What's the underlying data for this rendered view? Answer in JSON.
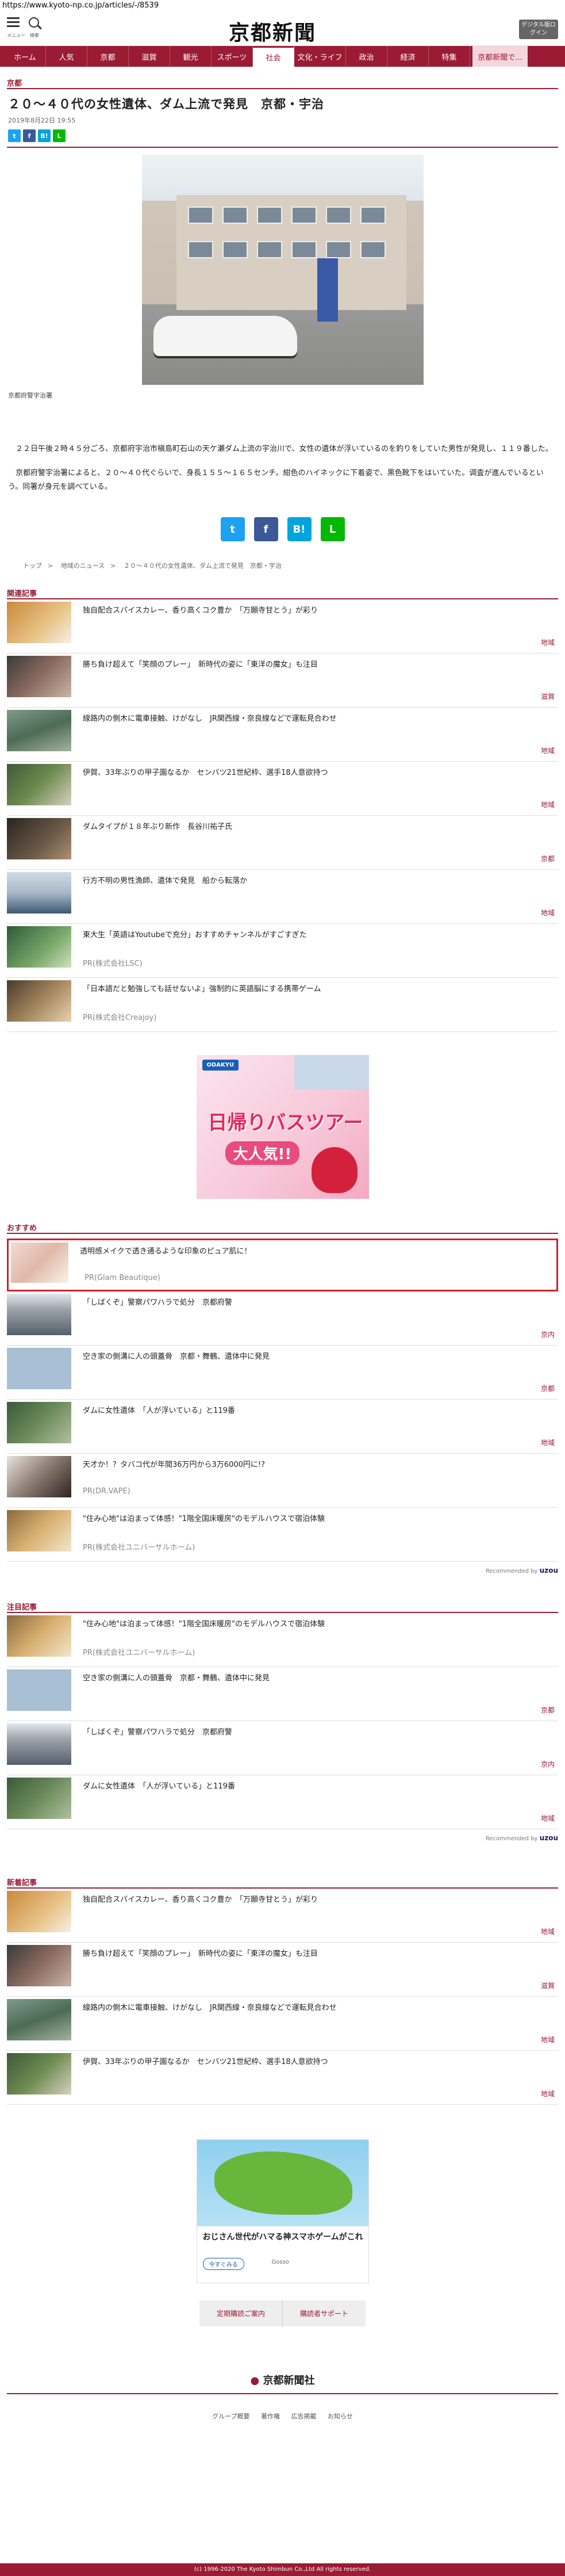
{
  "url": "https://www.kyoto-np.co.jp/articles/-/8539",
  "header": {
    "menu_label": "メニュー",
    "search_label": "検索",
    "logo": "京都新聞",
    "digital_btn": "デジタル版ログイン"
  },
  "nav": [
    "ホーム",
    "人気",
    "京都",
    "滋賀",
    "観光",
    "スポーツ",
    "社会",
    "文化・ライフ",
    "政治",
    "経済",
    "特集",
    "京都新聞で..."
  ],
  "article": {
    "section": "京都",
    "title": "２０～４０代の女性遺体、ダム上流で発見　京都・宇治",
    "date": "2019年8月22日 19:55",
    "photo_caption": "京都府警宇治署",
    "paragraphs": [
      "　２２日午後２時４５分ごろ、京都府宇治市槇島町石山の天ケ瀬ダム上流の宇治川で、女性の遺体が浮いているのを釣りをしていた男性が発見し、１１９番した。",
      "　京都府警宇治署によると、２０～４０代ぐらいで、身長１５５～１６５センチ。紺色のハイネックに下着姿で、黒色靴下をはいていた。调査が進んでいるという。同署が身元を調べている。"
    ]
  },
  "breadcrumb": [
    "トップ",
    "地域のニュース",
    "２０～４０代の女性遺体、ダム上流で発見　京都・宇治"
  ],
  "related": {
    "heading": "関連記事",
    "items": [
      {
        "text": "独自配合スパイスカレー、香り高くコク豊か　「万願寺甘とう」が彩り",
        "cat": "地域"
      },
      {
        "text": "勝ち負け超えて「笑顔のプレー」　新時代の姿に「東洋の魔女」も注目",
        "cat": "滋賀"
      },
      {
        "text": "線路内の側木に電車接触、けがなし　JR関西線・奈良線などで運転見合わせ",
        "cat": "地域"
      },
      {
        "text": "伊賀、33年ぶりの甲子園なるか　センバツ21世紀枠、選手18人意欲持つ",
        "cat": "地域"
      },
      {
        "text": "ダムタイプが１８年ぶり新作　長谷川祐子氏",
        "cat": "京都"
      },
      {
        "text": "行方不明の男性漁師、遺体で発見　船から転落か",
        "cat": "地域"
      },
      {
        "text": "東大生「英語はYoutubeで充分」おすすめチャンネルがすごすぎた",
        "pr": "PR(株式会社LSC)"
      },
      {
        "text": "「日本語だと勉強しても話せないよ」強制的に英語脳にする携帯ゲーム",
        "pr": "PR(株式会社Creajoy)"
      }
    ]
  },
  "ad1": {
    "brand": "ODAKYU",
    "title": "日帰りバスツアー",
    "sub": "大人気!!"
  },
  "osusume": {
    "heading": "おすすめ",
    "items": [
      {
        "text": "透明感メイクで透き通るような印象のピュア肌に！",
        "pr": "PR(Glam Beautique)"
      },
      {
        "text": "「しばくぞ」警察パワハラで処分　京都府警",
        "cat": "京内"
      },
      {
        "text": "空き家の側溝に人の頭蓋骨　京都・舞鶴、遺体中に発見",
        "cat": "京都"
      },
      {
        "text": "ダムに女性遺体　「人が浮いている」と119番",
        "cat": "地域"
      },
      {
        "text": "天才か！？タバコ代が年間36万円から3万6000円に!?",
        "pr": "PR(DR.VAPE)"
      },
      {
        "text": "\"住み心地\"は泊まって体感！\"1階全国床暖房\"のモデルハウスで宿泊体験",
        "pr": "PR(株式会社ユニバーサルホーム)"
      }
    ],
    "recommended": "Recommended by",
    "recommended_brand": "uzou"
  },
  "chumoku": {
    "heading": "注目記事",
    "items": [
      {
        "text": "\"住み心地\"は泊まって体感！\"1階全国床暖房\"のモデルハウスで宿泊体験",
        "pr": "PR(株式会社ユニバーサルホーム)"
      },
      {
        "text": "空き家の側溝に人の頭蓋骨　京都・舞鶴、遺体中に発見",
        "cat": "京都"
      },
      {
        "text": "「しばくぞ」警察パワハラで処分　京都府警",
        "cat": "京内"
      },
      {
        "text": "ダムに女性遺体　「人が浮いている」と119番",
        "cat": "地域"
      }
    ],
    "recommended": "Recommended by",
    "recommended_brand": "uzou"
  },
  "latest": {
    "heading": "新着記事",
    "items": [
      {
        "text": "独自配合スパイスカレー、香り高くコク豊か　「万願寺甘とう」が彩り",
        "cat": "地域"
      },
      {
        "text": "勝ち負け超えて「笑顔のプレー」　新時代の姿に「東洋の魔女」も注目",
        "cat": "滋賀"
      },
      {
        "text": "線路内の側木に電車接触、けがなし　JR関西線・奈良線などで運転見合わせ",
        "cat": "地域"
      },
      {
        "text": "伊賀、33年ぶりの甲子園なるか　センバツ21世紀枠、選手18人意欲持つ",
        "cat": "地域"
      }
    ]
  },
  "ad2": {
    "title": "おじさん世代がハマる神スマホゲームがこれ",
    "btn": "今すぐみる",
    "brand": "Gosso"
  },
  "subscribe": [
    "定期購読ご案内",
    "購読者サポート"
  ],
  "footer": {
    "logo": "京都新聞社",
    "links": [
      "グループ概要",
      "著作権",
      "広告掲載",
      "お知らせ"
    ],
    "copyright": "(c) 1996-2020 The Kyoto Shimbun Co.,Ltd All rights reserved."
  },
  "colors": {
    "brand": "#9a1b33",
    "highlight": "#d0202e"
  }
}
